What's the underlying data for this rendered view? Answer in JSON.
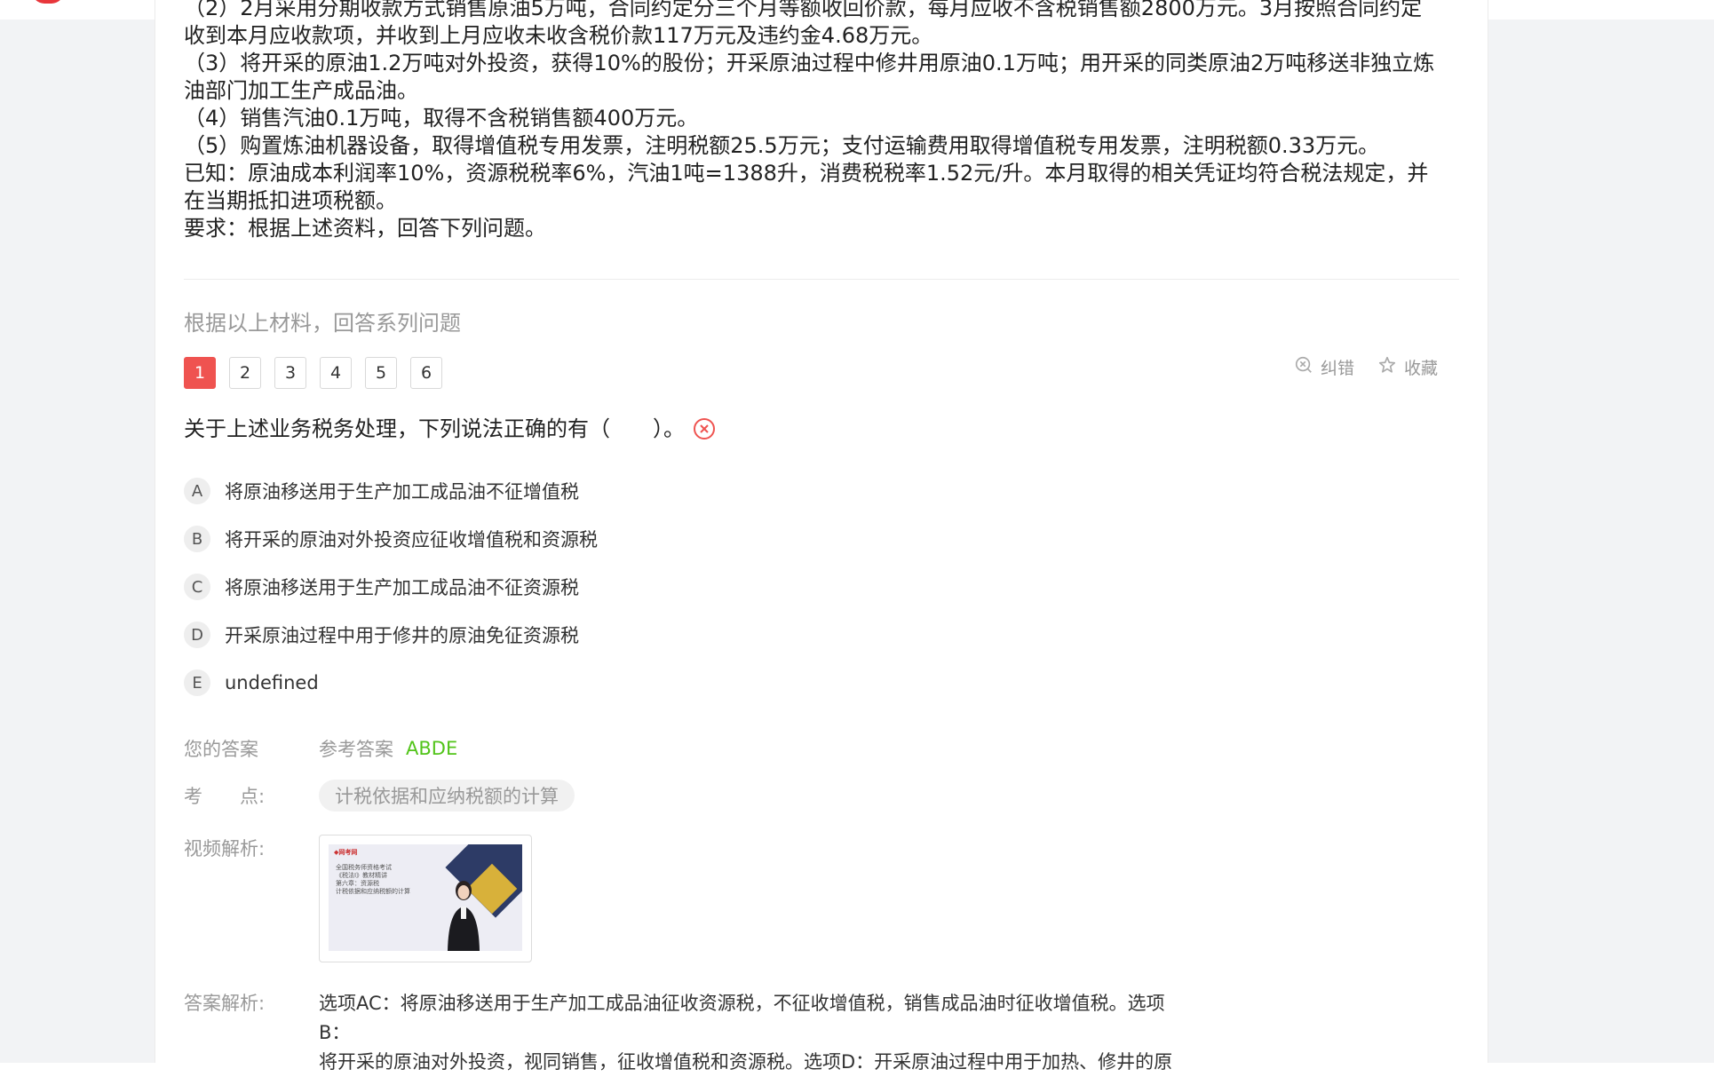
{
  "material": {
    "lines": [
      "（2）2月采用分期收款方式销售原油5万吨，合同约定分三个月等额收回价款，每月应收不含税销售额2800万元。3月按照合同约定收到本月应收款项，并收到上月应收未收含税价款117万元及违约金4.68万元。",
      "（3）将开采的原油1.2万吨对外投资，获得10%的股份；开采原油过程中修井用原油0.1万吨；用开采的同类原油2万吨移送非独立炼油部门加工生产成品油。",
      "（4）销售汽油0.1万吨，取得不含税销售额400万元。",
      "（5）购置炼油机器设备，取得增值税专用发票，注明税额25.5万元；支付运输费用取得增值税专用发票，注明税额0.33万元。",
      "已知：原油成本利润率10%，资源税税率6%，汽油1吨=1388升，消费税税率1.52元/升。本月取得的相关凭证均符合税法规定，并在当期抵扣进项税额。",
      "要求：根据上述资料，回答下列问题。"
    ]
  },
  "section_title": "根据以上材料，回答系列问题",
  "question_tabs": [
    "1",
    "2",
    "3",
    "4",
    "5",
    "6"
  ],
  "tools": {
    "correct_label": "纠错",
    "favorite_label": "收藏"
  },
  "question": {
    "text": "关于上述业务税务处理，下列说法正确的有（　　）。"
  },
  "options": [
    {
      "letter": "A",
      "text": "将原油移送用于生产加工成品油不征增值税"
    },
    {
      "letter": "B",
      "text": "将开采的原油对外投资应征收增值税和资源税"
    },
    {
      "letter": "C",
      "text": "将原油移送用于生产加工成品油不征资源税"
    },
    {
      "letter": "D",
      "text": "开采原油过程中用于修井的原油免征资源税"
    },
    {
      "letter": "E",
      "text": "undefined"
    }
  ],
  "answer": {
    "your_answer_label": "您的答案",
    "ref_label": "参考答案",
    "ref_value": "ABDE"
  },
  "key_point": {
    "label": "考　　点:",
    "tag": "计税依据和应纳税额的计算"
  },
  "video": {
    "label": "视频解析:",
    "thumb_logo": "◆网考网",
    "thumb_lines": [
      "全国税务师资格考试",
      "《税法Ⅰ》教材精讲",
      "第六章：资源税",
      "计税依据和应纳税额的计算"
    ]
  },
  "analysis": {
    "label": "答案解析:",
    "lines": [
      "选项AC：将原油移送用于生产加工成品油征收资源税，不征收增值税，销售成品油时征收增值税。选项B：",
      "将开采的原油对外投资，视同销售，征收增值税和资源税。选项D：开采原油过程中用于加热、修井的原"
    ]
  },
  "colors": {
    "accent": "#ef5350",
    "answer_green": "#52c41a"
  }
}
